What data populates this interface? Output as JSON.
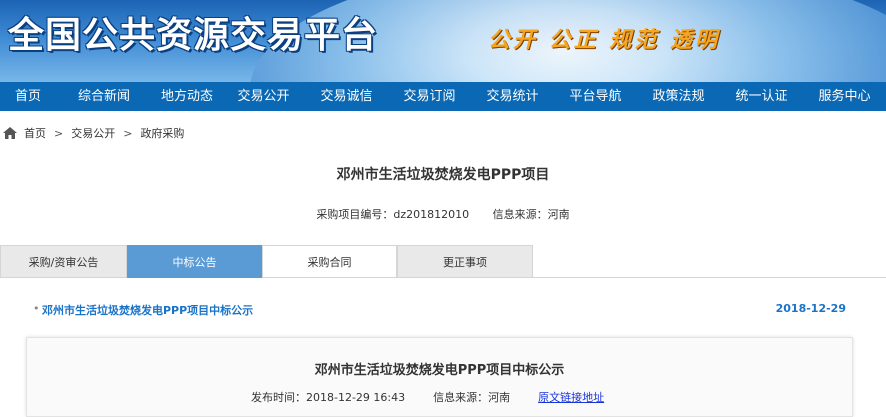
{
  "header": {
    "site_title": "全国公共资源交易平台",
    "slogan": "公开 公正 规范 透明"
  },
  "nav": {
    "items": [
      {
        "label": "首页"
      },
      {
        "label": "综合新闻"
      },
      {
        "label": "地方动态"
      },
      {
        "label": "交易公开"
      },
      {
        "label": "交易诚信"
      },
      {
        "label": "交易订阅"
      },
      {
        "label": "交易统计"
      },
      {
        "label": "平台导航"
      },
      {
        "label": "政策法规"
      },
      {
        "label": "统一认证"
      },
      {
        "label": "服务中心"
      }
    ]
  },
  "breadcrumb": {
    "items": [
      "首页",
      "交易公开",
      "政府采购"
    ],
    "separator": ">"
  },
  "project": {
    "title": "邓州市生活垃圾焚烧发电PPP项目",
    "code_label": "采购项目编号：",
    "code_value": "dz201812010",
    "source_label": "信息来源：",
    "source_value": "河南"
  },
  "tabs": [
    {
      "label": "采购/资审公告",
      "active": false
    },
    {
      "label": "中标公告",
      "active": true
    },
    {
      "label": "采购合同",
      "active": false
    },
    {
      "label": "更正事项",
      "active": false
    }
  ],
  "notice": {
    "bullet": "•",
    "title": "邓州市生活垃圾焚烧发电PPP项目中标公示",
    "date": "2018-12-29"
  },
  "detail": {
    "title": "邓州市生活垃圾焚烧发电PPP项目中标公示",
    "publish_label": "发布时间：",
    "publish_time": "2018-12-29 16:43",
    "source_label": "信息来源：",
    "source_value": "河南",
    "original_link": "原文链接地址"
  },
  "colors": {
    "nav_bg": "#0a68b4",
    "tab_active": "#5b9bd5",
    "link": "#1a73c8"
  }
}
